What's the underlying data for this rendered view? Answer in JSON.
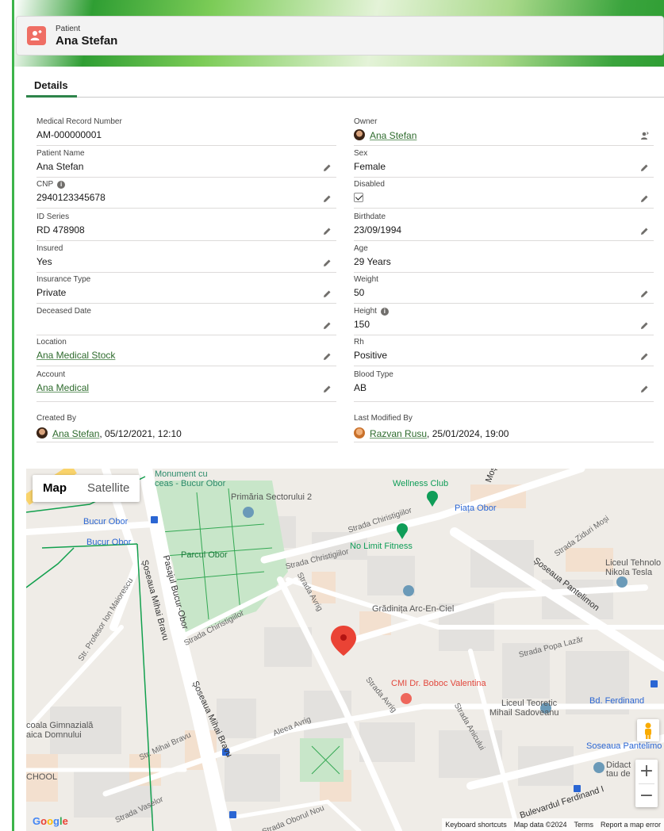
{
  "header": {
    "object_type": "Patient",
    "record_name": "Ana Stefan"
  },
  "tabs": [
    {
      "label": "Details",
      "active": true
    }
  ],
  "fields_left": [
    {
      "label": "Medical Record Number",
      "value": "AM-000000001",
      "editable": false
    },
    {
      "label": "Patient Name",
      "value": "Ana Stefan",
      "editable": true
    },
    {
      "label": "CNP",
      "value": "2940123345678",
      "editable": true,
      "info": true
    },
    {
      "label": "ID Series",
      "value": "RD 478908",
      "editable": true
    },
    {
      "label": "Insured",
      "value": "Yes",
      "editable": true
    },
    {
      "label": "Insurance Type",
      "value": "Private",
      "editable": true
    },
    {
      "label": "Deceased Date",
      "value": "",
      "editable": true
    },
    {
      "label": "Location",
      "value": "Ana Medical Stock",
      "editable": true,
      "link": true
    },
    {
      "label": "Account",
      "value": "Ana Medical",
      "editable": true,
      "link": true
    }
  ],
  "fields_right": [
    {
      "label": "Owner",
      "value": "Ana Stefan",
      "link": true,
      "avatar": "ana"
    },
    {
      "label": "Sex",
      "value": "Female",
      "editable": true
    },
    {
      "label": "Disabled",
      "checked": true,
      "editable": true
    },
    {
      "label": "Birthdate",
      "value": "23/09/1994",
      "editable": true
    },
    {
      "label": "Age",
      "value": "29 Years",
      "editable": false
    },
    {
      "label": "Weight",
      "value": "50",
      "editable": true
    },
    {
      "label": "Height",
      "value": "150",
      "editable": true,
      "info": true
    },
    {
      "label": "Rh",
      "value": "Positive",
      "editable": true
    },
    {
      "label": "Blood Type",
      "value": "AB",
      "editable": true
    }
  ],
  "created_by": {
    "label": "Created By",
    "user": "Ana Stefan",
    "timestamp": ", 05/12/2021, 12:10"
  },
  "last_modified_by": {
    "label": "Last Modified By",
    "user": "Razvan Rusu",
    "timestamp": ", 25/01/2024, 19:00"
  },
  "map": {
    "toggle": {
      "map": "Map",
      "satellite": "Satellite",
      "selected": "Map"
    },
    "labels": {
      "monument": "Monument cu",
      "monument2": "ceas - Bucur Obor",
      "primaria": "Primăria Sectorului 2",
      "wellness": "Wellness Club",
      "piata": "Piața Obor",
      "bucur_obor_1": "Bucur Obor",
      "bucur_obor_2": "Bucur Obor",
      "parcul": "Parcul Obor",
      "nolimit": "No Limit Fitness",
      "chiristigiilor": "Strada Christigiilor",
      "chiristigiilor2": "Strada Chiristigiilor",
      "chiristigiilor3": "Strada Chiristigiilor",
      "ziduri": "Strada Ziduri Moși",
      "liceul_nt": "Liceul Tehnolo",
      "liceul_nt2": "Nikola Tesla",
      "pasajul": "Pasajul Bucur-Obor",
      "mihai_bravu_sos": "Șoseaua Mihai Bravu",
      "mihai_bravu_sos2": "Șoseaua Mihai Bravu",
      "maiorescu": "Str. Profesor Ion Maiorescu",
      "avrig": "Strada Avrig",
      "avrig2": "Strada Avrig",
      "gradinita": "Grădinița Arc-En-Ciel",
      "pantelimon": "Șoseaua Pantelimon",
      "popa_lazar": "Strada Popa Lazăr",
      "boboc": "CMI Dr. Boboc Valentina",
      "liceul_ms": "Liceul Teoretic",
      "liceul_ms2": "Mihail Sadoveanu",
      "ferdinand": "Bd. Ferdinand",
      "sos_pantelimon": "Soseaua Pantelimo",
      "didact": "Didact",
      "didact2": "tau de",
      "scoala": "coala Gimnazială",
      "scoala2": "aica Domnului",
      "school": "CHOOL",
      "str_mihai_bravu": "Str. Mihai Bravu",
      "aleea_avrig": "Aleea Avrig",
      "anicului": "Strada Anicului",
      "vaselor": "Strada Vaselor",
      "oborul_nou": "Strada Oborul Nou",
      "ferdinand_blvd": "Bulevardul Ferdinand I",
      "mosi": "Moși"
    },
    "google_logo": "Google",
    "footer": {
      "shortcuts": "Keyboard shortcuts",
      "mapdata": "Map data ©2024",
      "terms": "Terms",
      "report": "Report a map error"
    },
    "zoom_in": "+",
    "zoom_out": "−",
    "colors": {
      "park": "#c8e6c9",
      "road": "#ffffff",
      "pin": "#ea4335",
      "poi_green": "#0f9d58"
    }
  }
}
